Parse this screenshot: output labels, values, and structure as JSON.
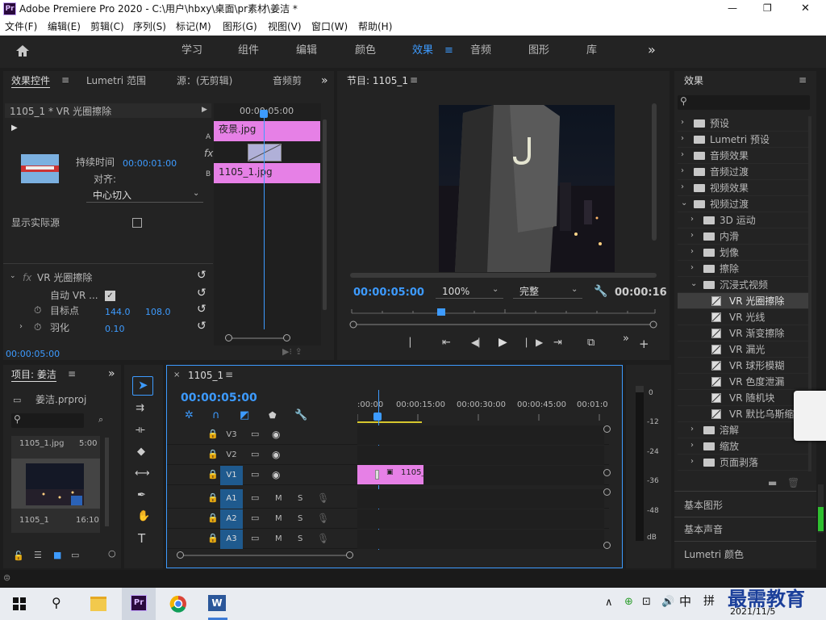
{
  "window": {
    "title": "Adobe Premiere Pro 2020 - C:\\用户\\hbxy\\桌面\\pr素材\\姜洁 *",
    "app_badge": "Pr",
    "min": "—",
    "max": "❐",
    "close": "✕"
  },
  "menu": [
    "文件(F)",
    "编辑(E)",
    "剪辑(C)",
    "序列(S)",
    "标记(M)",
    "图形(G)",
    "视图(V)",
    "窗口(W)",
    "帮助(H)"
  ],
  "workspaces": {
    "items": [
      "学习",
      "组件",
      "编辑",
      "颜色",
      "效果",
      "音频",
      "图形",
      "库"
    ],
    "active": "效果",
    "more": "»"
  },
  "effect_controls": {
    "tabs": [
      "效果控件",
      "Lumetri 范围",
      "源：(无剪辑)",
      "音频剪"
    ],
    "clip_path": "1105_1 * VR 光圈擦除",
    "duration_label": "持续时间",
    "duration_value": "00:00:01:00",
    "align_label": "对齐:",
    "align_value": "中心切入",
    "show_source": "显示实际源",
    "timecode_mini": "00:00:05:00",
    "track_a_label": "A",
    "track_b_label": "B",
    "clip_a": "夜景.jpg",
    "clip_b": "1105_1.jpg",
    "fx": "fx",
    "section": "VR 光圈擦除",
    "auto_vr": "自动 VR ...",
    "target_label": "目标点",
    "target_x": "144.0",
    "target_y": "108.0",
    "feather_label": "羽化",
    "feather_value": "0.10",
    "footer_time": "00:00:05:00"
  },
  "program": {
    "title": "节目: 1105_1",
    "timecode": "00:00:05:00",
    "zoom": "100%",
    "quality": "完整",
    "duration": "00:00:16"
  },
  "effects": {
    "title": "效果",
    "search_placeholder": "",
    "tree": [
      {
        "label": "预设",
        "level": 0,
        "type": "folder-star"
      },
      {
        "label": "Lumetri 预设",
        "level": 0,
        "type": "folder-star"
      },
      {
        "label": "音频效果",
        "level": 0,
        "type": "folder"
      },
      {
        "label": "音频过渡",
        "level": 0,
        "type": "folder"
      },
      {
        "label": "视频效果",
        "level": 0,
        "type": "folder"
      },
      {
        "label": "视频过渡",
        "level": 0,
        "type": "folder",
        "open": true
      },
      {
        "label": "3D 运动",
        "level": 1,
        "type": "folder"
      },
      {
        "label": "内滑",
        "level": 1,
        "type": "folder"
      },
      {
        "label": "划像",
        "level": 1,
        "type": "folder"
      },
      {
        "label": "擦除",
        "level": 1,
        "type": "folder"
      },
      {
        "label": "沉浸式视频",
        "level": 1,
        "type": "folder",
        "open": true
      },
      {
        "label": "VR 光圈擦除",
        "level": 2,
        "type": "fx",
        "selected": true
      },
      {
        "label": "VR 光线",
        "level": 2,
        "type": "fx"
      },
      {
        "label": "VR 渐变擦除",
        "level": 2,
        "type": "fx"
      },
      {
        "label": "VR 漏光",
        "level": 2,
        "type": "fx"
      },
      {
        "label": "VR 球形模糊",
        "level": 2,
        "type": "fx"
      },
      {
        "label": "VR 色度泄漏",
        "level": 2,
        "type": "fx"
      },
      {
        "label": "VR 随机块",
        "level": 2,
        "type": "fx"
      },
      {
        "label": "VR 默比乌斯缩",
        "level": 2,
        "type": "fx"
      },
      {
        "label": "溶解",
        "level": 1,
        "type": "folder"
      },
      {
        "label": "缩放",
        "level": 1,
        "type": "folder"
      },
      {
        "label": "页面剥落",
        "level": 1,
        "type": "folder"
      }
    ],
    "sections": [
      "基本图形",
      "基本声音",
      "Lumetri 颜色"
    ]
  },
  "project": {
    "title": "项目: 姜洁",
    "file": "姜洁.prproj",
    "items": [
      {
        "name": "1105_1.jpg",
        "dur": "5:00"
      },
      {
        "name": "1105_1",
        "dur": "16:10"
      }
    ]
  },
  "timeline": {
    "tab": "1105_1",
    "timecode": "00:00:05:00",
    "ruler": [
      ":00:00",
      "00:00:15:00",
      "00:00:30:00",
      "00:00:45:00",
      "00:01:0"
    ],
    "video_tracks": [
      "V3",
      "V2",
      "V1"
    ],
    "audio_tracks": [
      "A1",
      "A2",
      "A3"
    ],
    "clip": "1105_",
    "m": "M",
    "s": "S"
  },
  "meter": {
    "scale": [
      "0",
      "-12",
      "-24",
      "-36",
      "-48",
      "dB"
    ]
  },
  "taskbar": {
    "ime": "中",
    "ime2": "拼",
    "time": "",
    "date": "2021/11/5",
    "watermark": "最需教育"
  }
}
